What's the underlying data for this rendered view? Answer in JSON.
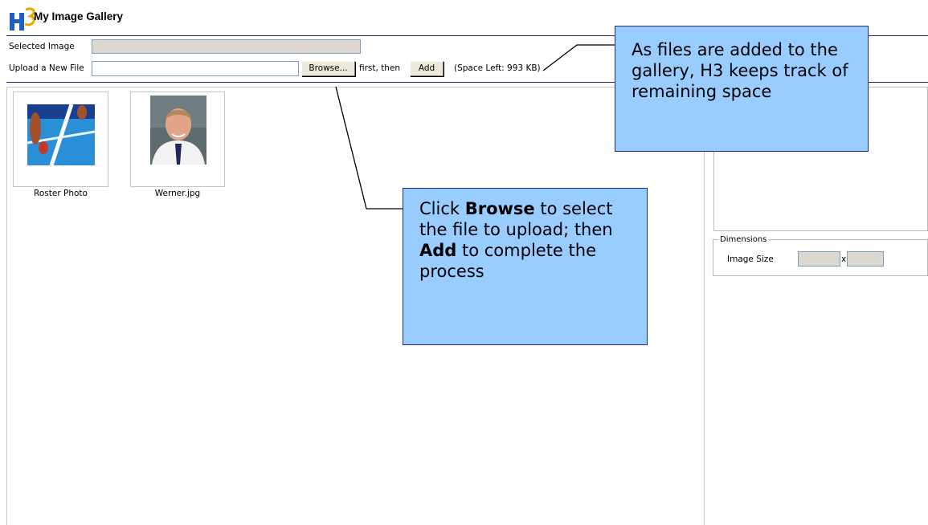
{
  "header": {
    "title": "My Image Gallery"
  },
  "form": {
    "selected_image_label": "Selected Image",
    "selected_image_value": "",
    "upload_label": "Upload a New File",
    "upload_value": "",
    "browse_label": "Browse...",
    "first_then": "first, then",
    "add_label": "Add",
    "space_left": "(Space Left: 993 KB)"
  },
  "gallery": {
    "items": [
      {
        "caption": "Roster Photo",
        "icon": "tennis-photo"
      },
      {
        "caption": "Werner.jpg",
        "icon": "portrait-photo"
      }
    ]
  },
  "details": {
    "dimensions_legend": "Dimensions",
    "image_size_label": "Image Size",
    "width_value": "",
    "x_sep": "x",
    "height_value": ""
  },
  "callouts": {
    "space": "As files are added to the gallery, H3 keeps track of remaining space",
    "browse_pre": "Click ",
    "browse_b1": "Browse",
    "browse_mid1": " to select the file to upload; then ",
    "browse_b2": "Add",
    "browse_mid2": " to complete the process"
  },
  "colors": {
    "callout_fill": "#99ccff",
    "rule": "#1a2a7a"
  }
}
